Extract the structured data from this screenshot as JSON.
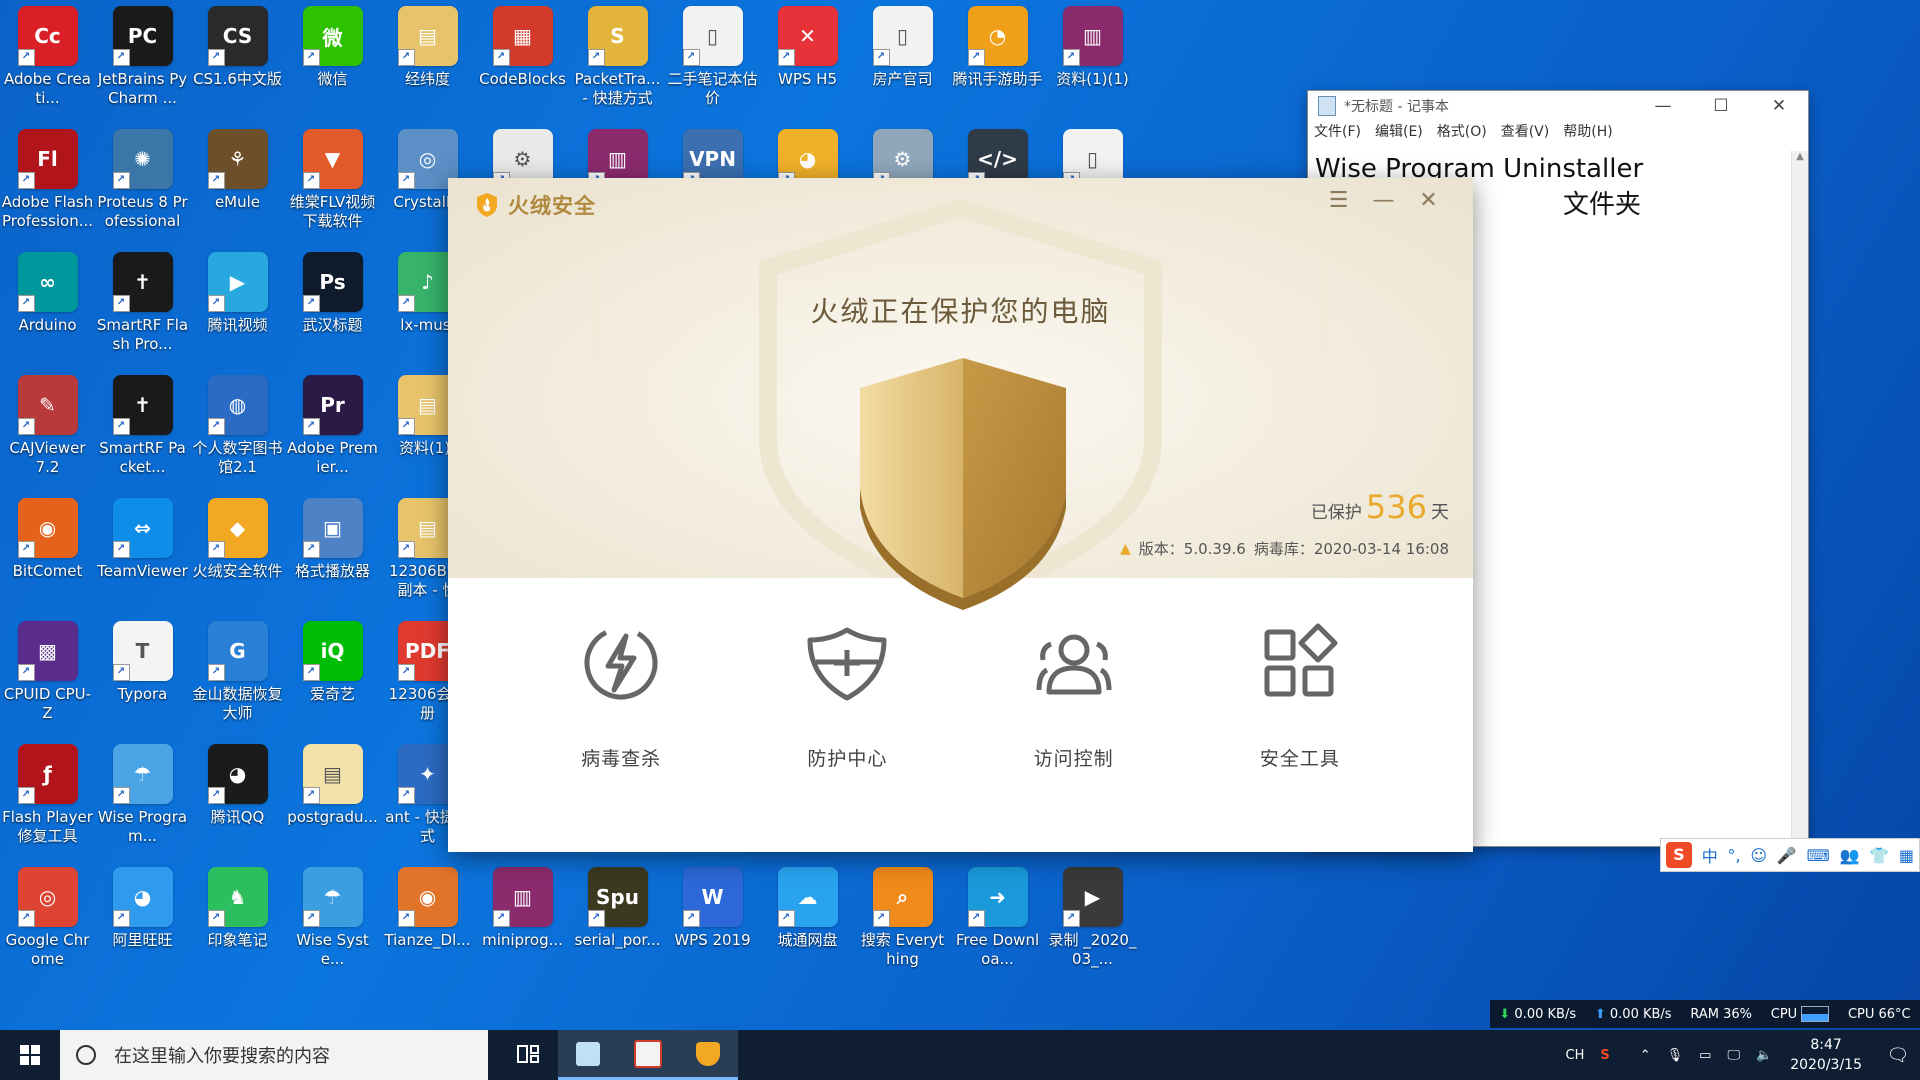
{
  "desktop": {
    "icons": [
      {
        "label": "Adobe Creati...",
        "glyph": "Cc",
        "color": "#da1f26"
      },
      {
        "label": "JetBrains PyCharm ...",
        "glyph": "PC",
        "color": "#1a1a1a"
      },
      {
        "label": "CS1.6中文版",
        "glyph": "CS",
        "color": "#2a2a2a"
      },
      {
        "label": "微信",
        "glyph": "微",
        "color": "#2dc100"
      },
      {
        "label": "经纬度",
        "glyph": "▤",
        "color": "#e7c46b"
      },
      {
        "label": "CodeBlocks",
        "glyph": "▦",
        "color": "#d23b2c"
      },
      {
        "label": "PacketTra... - 快捷方式",
        "glyph": "S",
        "color": "#e2b43c"
      },
      {
        "label": "二手笔记本估价",
        "glyph": "▯",
        "color": "#f2f2f2"
      },
      {
        "label": "WPS H5",
        "glyph": "✕",
        "color": "#e8323a"
      },
      {
        "label": "房产官司",
        "glyph": "▯",
        "color": "#f2f2f2"
      },
      {
        "label": "腾讯手游助手",
        "glyph": "◔",
        "color": "#f0a018"
      },
      {
        "label": "资料(1)(1)",
        "glyph": "▥",
        "color": "#8c2a6e"
      },
      {
        "label": "Adobe Flash Profession...",
        "glyph": "Fl",
        "color": "#b1141a"
      },
      {
        "label": "Proteus 8 Professional",
        "glyph": "✺",
        "color": "#3a76a8"
      },
      {
        "label": "eMule",
        "glyph": "⚘",
        "color": "#6e4f2c"
      },
      {
        "label": "维棠FLV视频下载软件",
        "glyph": "▼",
        "color": "#e35a2a"
      },
      {
        "label": "CrystalDi",
        "glyph": "◎",
        "color": "#5b8fc6"
      },
      {
        "label": "",
        "glyph": "⚙",
        "color": "#e9e9e9"
      },
      {
        "label": "",
        "glyph": "▥",
        "color": "#8c2a6e"
      },
      {
        "label": "",
        "glyph": "VPN",
        "color": "#3c6fb0"
      },
      {
        "label": "",
        "glyph": "◕",
        "color": "#f0b02a"
      },
      {
        "label": "",
        "glyph": "⚙",
        "color": "#8fa6bb"
      },
      {
        "label": "",
        "glyph": "</>",
        "color": "#2f3b48"
      },
      {
        "label": "",
        "glyph": "▯",
        "color": "#f2f2f2"
      },
      {
        "label": "Arduino",
        "glyph": "∞",
        "color": "#00979c"
      },
      {
        "label": "SmartRF Flash Pro...",
        "glyph": "✝",
        "color": "#1a1a1a"
      },
      {
        "label": "腾讯视频",
        "glyph": "▶",
        "color": "#29a8e0"
      },
      {
        "label": "武汉标题",
        "glyph": "Ps",
        "color": "#0f1a2b"
      },
      {
        "label": "lx-musi",
        "glyph": "♪",
        "color": "#37b36a"
      },
      {
        "label": "",
        "glyph": "",
        "color": "transparent"
      },
      {
        "label": "",
        "glyph": "",
        "color": "transparent"
      },
      {
        "label": "",
        "glyph": "",
        "color": "transparent"
      },
      {
        "label": "",
        "glyph": "",
        "color": "transparent"
      },
      {
        "label": "",
        "glyph": "",
        "color": "transparent"
      },
      {
        "label": "",
        "glyph": "",
        "color": "transparent"
      },
      {
        "label": "",
        "glyph": "",
        "color": "transparent"
      },
      {
        "label": "CAJViewer 7.2",
        "glyph": "✎",
        "color": "#b93a3a"
      },
      {
        "label": "SmartRF Packet...",
        "glyph": "✝",
        "color": "#1a1a1a"
      },
      {
        "label": "个人数字图书馆2.1",
        "glyph": "◍",
        "color": "#2c6bc4"
      },
      {
        "label": "Adobe Premier...",
        "glyph": "Pr",
        "color": "#2b1946"
      },
      {
        "label": "资料(1)(",
        "glyph": "▤",
        "color": "#e7c46b"
      },
      {
        "label": "",
        "glyph": "",
        "color": "transparent"
      },
      {
        "label": "",
        "glyph": "",
        "color": "transparent"
      },
      {
        "label": "",
        "glyph": "",
        "color": "transparent"
      },
      {
        "label": "",
        "glyph": "",
        "color": "transparent"
      },
      {
        "label": "",
        "glyph": "",
        "color": "transparent"
      },
      {
        "label": "",
        "glyph": "",
        "color": "transparent"
      },
      {
        "label": "",
        "glyph": "",
        "color": "transparent"
      },
      {
        "label": "BitComet",
        "glyph": "◉",
        "color": "#e4621b"
      },
      {
        "label": "TeamViewer",
        "glyph": "⇔",
        "color": "#0e8ee9"
      },
      {
        "label": "火绒安全软件",
        "glyph": "◆",
        "color": "#f3a823"
      },
      {
        "label": "格式播放器",
        "glyph": "▣",
        "color": "#4d82c7"
      },
      {
        "label": "12306By - 副本 - 快",
        "glyph": "▤",
        "color": "#e7c46b"
      },
      {
        "label": "",
        "glyph": "",
        "color": "transparent"
      },
      {
        "label": "",
        "glyph": "",
        "color": "transparent"
      },
      {
        "label": "",
        "glyph": "",
        "color": "transparent"
      },
      {
        "label": "",
        "glyph": "",
        "color": "transparent"
      },
      {
        "label": "",
        "glyph": "",
        "color": "transparent"
      },
      {
        "label": "",
        "glyph": "",
        "color": "transparent"
      },
      {
        "label": "",
        "glyph": "",
        "color": "transparent"
      },
      {
        "label": "CPUID CPU-Z",
        "glyph": "▩",
        "color": "#5a2c8c"
      },
      {
        "label": "Typora",
        "glyph": "T",
        "color": "#f4f4f4"
      },
      {
        "label": "金山数据恢复大师",
        "glyph": "G",
        "color": "#2a7fd6"
      },
      {
        "label": "爱奇艺",
        "glyph": "iQ",
        "color": "#00be06"
      },
      {
        "label": "12306会员册",
        "glyph": "PDF",
        "color": "#e03a30"
      },
      {
        "label": "",
        "glyph": "",
        "color": "transparent"
      },
      {
        "label": "",
        "glyph": "",
        "color": "transparent"
      },
      {
        "label": "",
        "glyph": "",
        "color": "transparent"
      },
      {
        "label": "",
        "glyph": "",
        "color": "transparent"
      },
      {
        "label": "",
        "glyph": "",
        "color": "transparent"
      },
      {
        "label": "",
        "glyph": "",
        "color": "transparent"
      },
      {
        "label": "",
        "glyph": "",
        "color": "transparent"
      },
      {
        "label": "Flash Player 修复工具",
        "glyph": "ƒ",
        "color": "#b1141a"
      },
      {
        "label": "Wise Program...",
        "glyph": "☂",
        "color": "#4aa4e5"
      },
      {
        "label": "腾讯QQ",
        "glyph": "◕",
        "color": "#1b1b1b"
      },
      {
        "label": "postgradu...",
        "glyph": "▤",
        "color": "#f2e2a8"
      },
      {
        "label": "ant - 快捷方式",
        "glyph": "✦",
        "color": "#2c6bc4"
      },
      {
        "label": "",
        "glyph": "",
        "color": "transparent"
      },
      {
        "label": "",
        "glyph": "",
        "color": "transparent"
      },
      {
        "label": "",
        "glyph": "",
        "color": "transparent"
      },
      {
        "label": "",
        "glyph": "",
        "color": "transparent"
      },
      {
        "label": "",
        "glyph": "",
        "color": "transparent"
      },
      {
        "label": "",
        "glyph": "",
        "color": "transparent"
      },
      {
        "label": "",
        "glyph": "",
        "color": "transparent"
      },
      {
        "label": "Google Chrome",
        "glyph": "◎",
        "color": "#dd4433"
      },
      {
        "label": "阿里旺旺",
        "glyph": "◕",
        "color": "#2e9bef"
      },
      {
        "label": "印象笔记",
        "glyph": "♞",
        "color": "#2dbe60"
      },
      {
        "label": "Wise Syste...",
        "glyph": "☂",
        "color": "#3a9ee0"
      },
      {
        "label": "Tianze_Dl...",
        "glyph": "◉",
        "color": "#e2742a"
      },
      {
        "label": "miniprog...",
        "glyph": "▥",
        "color": "#8c2a6e"
      },
      {
        "label": "serial_por...",
        "glyph": "Spu",
        "color": "#3b3a20"
      },
      {
        "label": "WPS 2019",
        "glyph": "W",
        "color": "#2d68d8"
      },
      {
        "label": "城通网盘",
        "glyph": "☁",
        "color": "#29a3f0"
      },
      {
        "label": "搜索 Everything",
        "glyph": "⌕",
        "color": "#f08a1a"
      },
      {
        "label": "Free Downloa...",
        "glyph": "➜",
        "color": "#1a9adb"
      },
      {
        "label": "录制 _2020_03_...",
        "glyph": "▶",
        "color": "#3a3a3a"
      }
    ]
  },
  "notepad": {
    "title": "*无标题 - 记事本",
    "menu": [
      "文件(F)",
      "编辑(E)",
      "格式(O)",
      "查看(V)",
      "帮助(H)"
    ],
    "content": "Wise Program Uninstaller\n                              文件夹",
    "controls": {
      "minimize": "—",
      "maximize": "☐",
      "close": "✕"
    }
  },
  "huorong": {
    "brand": "火绒安全",
    "heading": "火绒正在保护您的电脑",
    "protected_label": "已保护",
    "protected_days": "536",
    "days_unit": "天",
    "version_label": "版本：5.0.39.6",
    "virusdb_label": "病毒库：2020-03-14 16:08",
    "controls": {
      "menu": "☰",
      "minimize": "—",
      "close": "✕"
    },
    "tiles": [
      {
        "label": "病毒查杀",
        "icon": "lightning-icon"
      },
      {
        "label": "防护中心",
        "icon": "shield-plus-icon"
      },
      {
        "label": "访问控制",
        "icon": "users-icon"
      },
      {
        "label": "安全工具",
        "icon": "apps-icon"
      }
    ],
    "colors": {
      "gold": "#c9a45c",
      "accent": "#e9a92a",
      "text": "#6d5a3a"
    }
  },
  "ime": {
    "logo": "S",
    "items": [
      "中",
      "°,",
      "☺",
      "🎤",
      "⌨",
      "👥",
      "👕",
      "▦"
    ]
  },
  "meter": {
    "down": "0.00 KB/s",
    "up": "0.00 KB/s",
    "ram": "RAM 36%",
    "cpu_label": "CPU",
    "cpu_temp": "CPU 66°C"
  },
  "taskbar": {
    "search_placeholder": "在这里输入你要搜索的内容",
    "tray_lang": "CH",
    "time": "8:47",
    "date": "2020/3/15"
  }
}
